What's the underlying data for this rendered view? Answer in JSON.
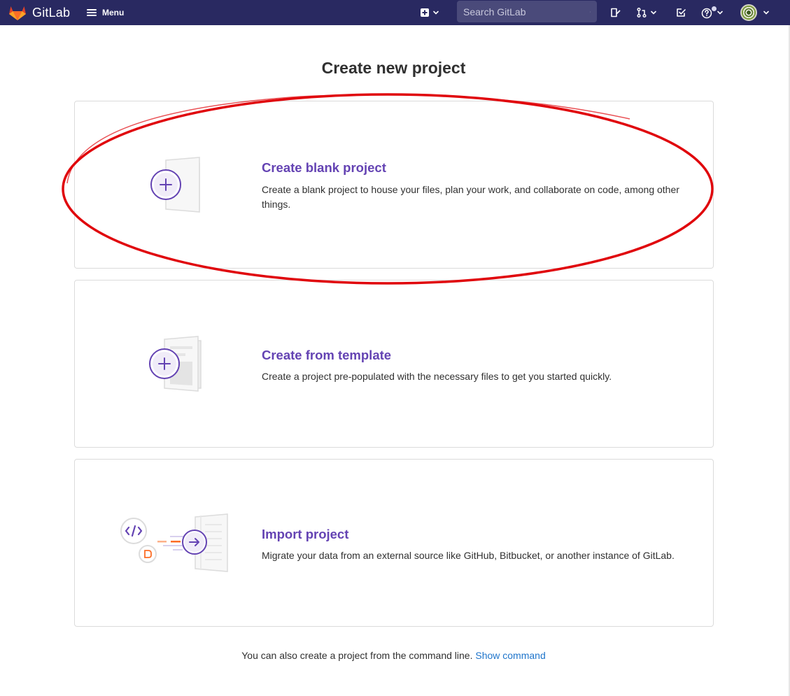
{
  "navbar": {
    "brand_name": "GitLab",
    "menu_label": "Menu",
    "search_placeholder": "Search GitLab",
    "icons": [
      "gitlab-tanuki-icon",
      "hamburger-icon",
      "plus-square-icon",
      "chevron-down-icon",
      "search-icon",
      "issues-icon",
      "merge-request-icon",
      "todo-icon",
      "help-icon",
      "avatar"
    ]
  },
  "page": {
    "title": "Create new project"
  },
  "options": [
    {
      "title": "Create blank project",
      "description": "Create a blank project to house your files, plan your work, and collaborate on code, among other things.",
      "icon": "blank-project-illustration"
    },
    {
      "title": "Create from template",
      "description": "Create a project pre-populated with the necessary files to get you started quickly.",
      "icon": "template-project-illustration"
    },
    {
      "title": "Import project",
      "description": "Migrate your data from an external source like GitHub, Bitbucket, or another instance of GitLab.",
      "icon": "import-project-illustration"
    }
  ],
  "footer": {
    "hint_text": "You can also create a project from the command line.",
    "link_text": "Show command"
  },
  "colors": {
    "navbar_bg": "#292961",
    "accent_purple": "#6443b3",
    "link_blue": "#1f75cb",
    "annotation_red": "#e0060c"
  }
}
